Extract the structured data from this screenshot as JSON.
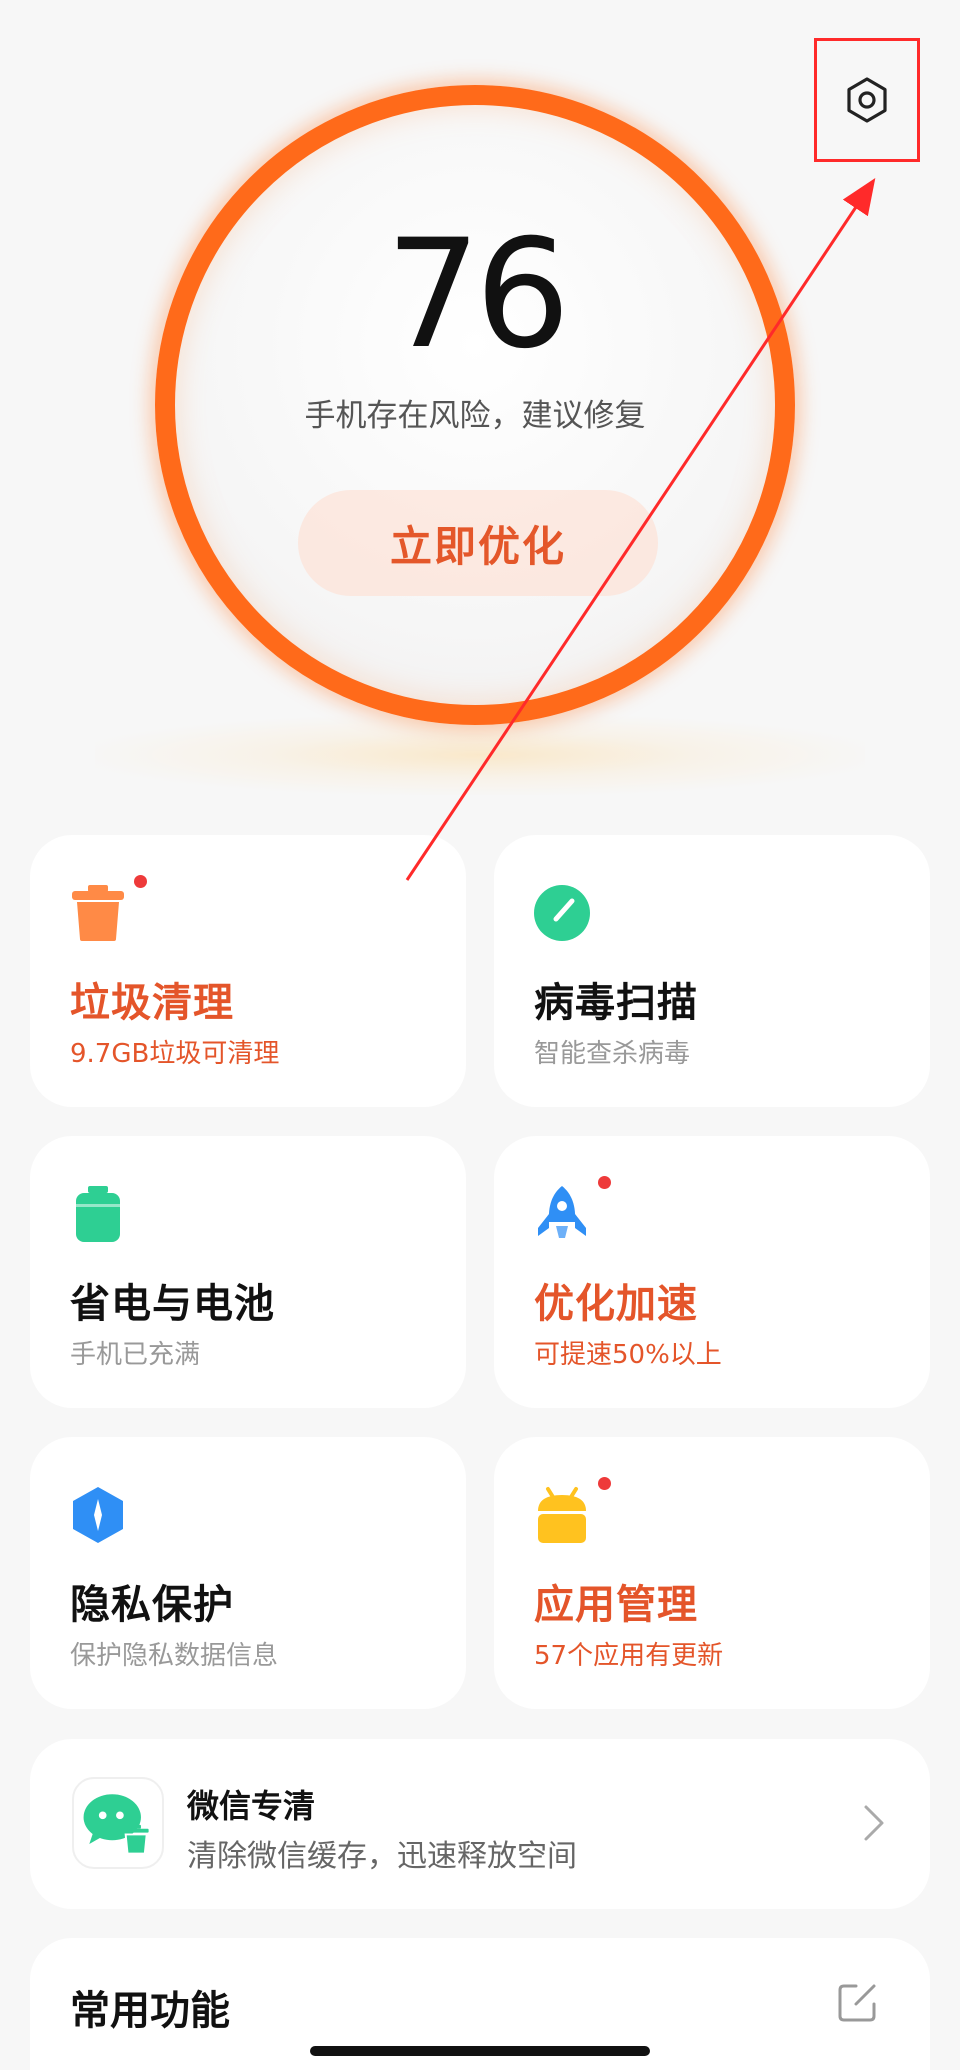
{
  "header": {
    "settings_icon": "settings-hexagon-icon"
  },
  "score": {
    "value": "76",
    "status_text": "手机存在风险，建议修复",
    "action_label": "立即优化",
    "ring_color": "#ff6a1a"
  },
  "cards": [
    {
      "title": "垃圾清理",
      "subtitle": "9.7GB垃圾可清理",
      "icon": "trash-can-icon",
      "warning": true,
      "badge": true
    },
    {
      "title": "病毒扫描",
      "subtitle": "智能查杀病毒",
      "icon": "virus-scan-icon",
      "warning": false,
      "badge": false
    },
    {
      "title": "省电与电池",
      "subtitle": "手机已充满",
      "icon": "battery-icon",
      "warning": false,
      "badge": false
    },
    {
      "title": "优化加速",
      "subtitle": "可提速50%以上",
      "icon": "rocket-icon",
      "warning": true,
      "badge": true
    },
    {
      "title": "隐私保护",
      "subtitle": "保护隐私数据信息",
      "icon": "privacy-shield-icon",
      "warning": false,
      "badge": false
    },
    {
      "title": "应用管理",
      "subtitle": "57个应用有更新",
      "icon": "android-app-icon",
      "warning": true,
      "badge": true
    }
  ],
  "wechat": {
    "title": "微信专清",
    "subtitle": "清除微信缓存，迅速释放空间",
    "icon": "wechat-clean-icon"
  },
  "common": {
    "title": "常用功能",
    "edit_icon": "edit-icon"
  },
  "colors": {
    "warning": "#e4552a",
    "badge": "#ee3a3a",
    "orange_icon": "#ff8a46",
    "green_icon": "#2ecf93",
    "blue_icon": "#2f8ff5",
    "yellow_icon": "#ffc21f"
  }
}
